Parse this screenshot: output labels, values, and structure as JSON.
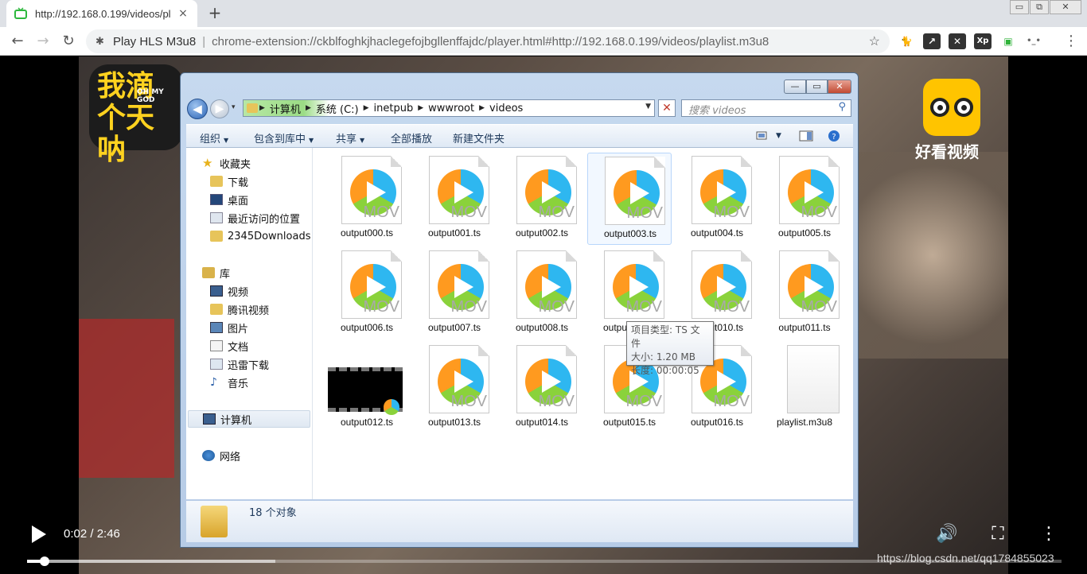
{
  "browser": {
    "tab_title": "http://192.168.0.199/videos/pl",
    "tab_close": "×",
    "new_tab": "+",
    "window_controls": [
      "▭",
      "⧉",
      "✕"
    ],
    "extension_name": "Play HLS M3u8",
    "url": "chrome-extension://ckblfoghkjhaclegefojbgllenffajdc/player.html#http://192.168.0.199/videos/playlist.m3u8",
    "extensions": [
      "🐈",
      "↗",
      "✕",
      "Xp",
      "▣",
      "•_•"
    ],
    "extension_colors": [
      "#d4a017",
      "#333333",
      "#333333",
      "#333333",
      "#30b33a",
      "#666666"
    ],
    "menu": "⋮"
  },
  "video": {
    "logo_left_text": "我滴个天呐",
    "logo_left_small": "OH MY GOD",
    "logo_right_text": "好看视频",
    "time": "0:02 / 2:46",
    "played_fraction": 0.017,
    "loaded_fraction": 0.24,
    "watermark": "https://blog.csdn.net/qq1784855023"
  },
  "explorer": {
    "window_buttons": {
      "min": "—",
      "max": "▭",
      "close": "✕"
    },
    "breadcrumbs": [
      "计算机",
      "系统 (C:)",
      "inetpub",
      "wwwroot",
      "videos"
    ],
    "search_placeholder": "搜索 videos",
    "commands": [
      "组织",
      "包含到库中",
      "共享",
      "全部播放",
      "新建文件夹"
    ],
    "nav": {
      "favorites_label": "收藏夹",
      "favorites": [
        "下载",
        "桌面",
        "最近访问的位置",
        "2345Downloads"
      ],
      "libraries_label": "库",
      "libraries": [
        "视频",
        "腾讯视频",
        "图片",
        "文档",
        "迅雷下载",
        "音乐"
      ],
      "computer": "计算机",
      "network": "网络"
    },
    "files": [
      "output000.ts",
      "output001.ts",
      "output002.ts",
      "output003.ts",
      "output004.ts",
      "output005.ts",
      "output006.ts",
      "output007.ts",
      "output008.ts",
      "output009.ts",
      "output010.ts",
      "output011.ts",
      "output012.ts",
      "output013.ts",
      "output014.ts",
      "output015.ts",
      "output016.ts",
      "playlist.m3u8"
    ],
    "file_badge": "MOV",
    "tooltip": {
      "type": "项目类型: TS 文件",
      "size": "大小: 1.20 MB",
      "length": "长度: 00:00:05"
    },
    "status": "18 个对象"
  }
}
